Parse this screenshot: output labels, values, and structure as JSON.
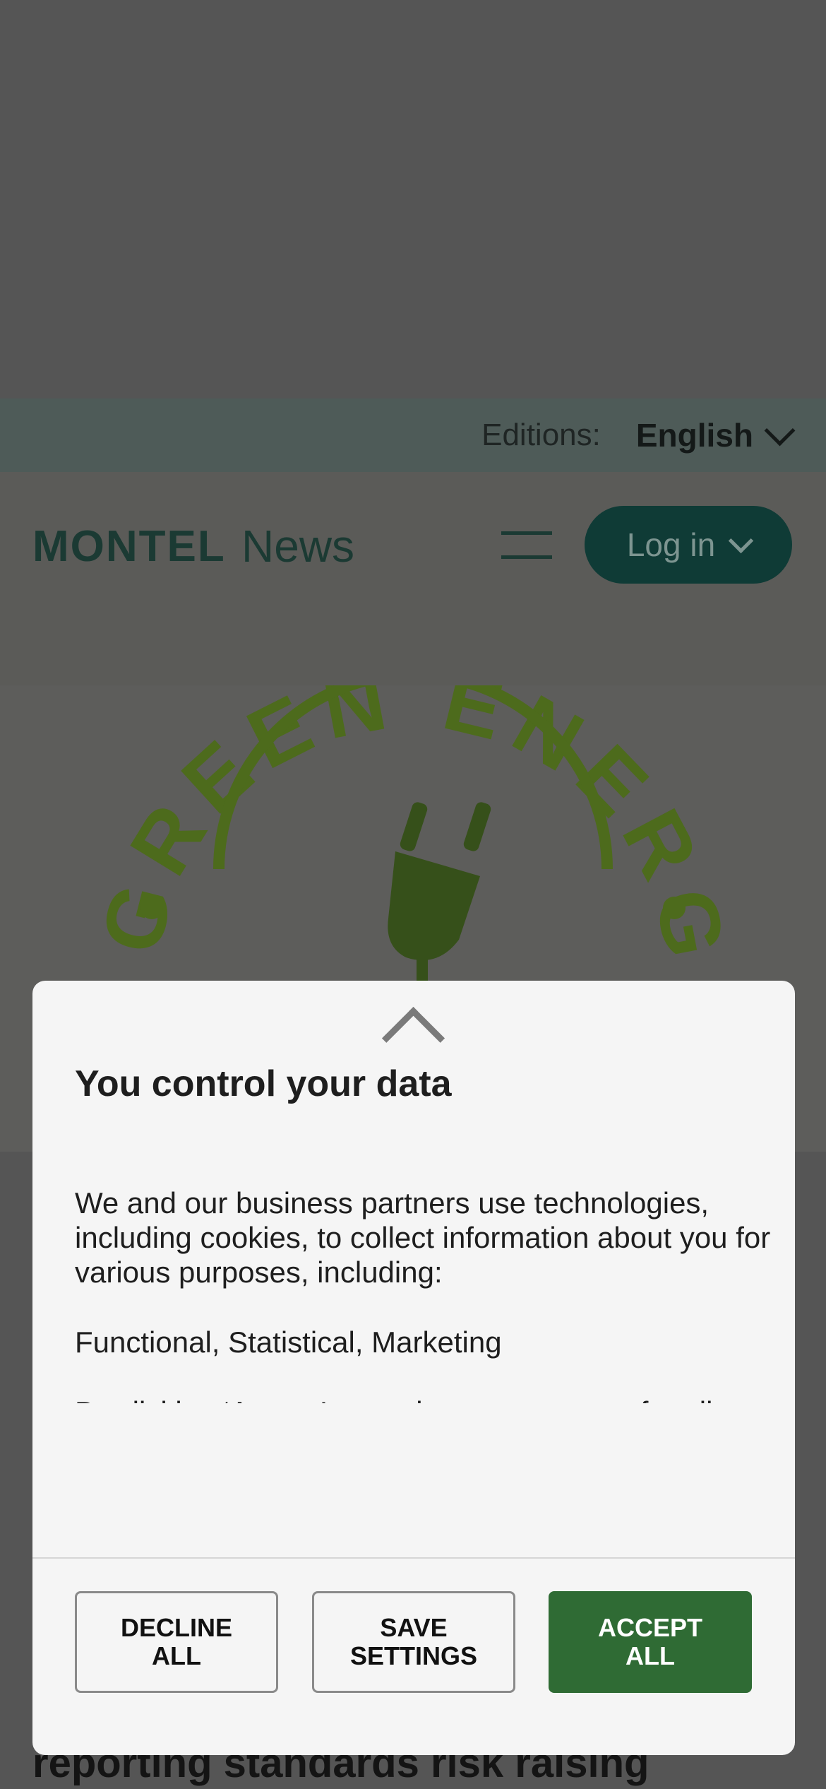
{
  "editions": {
    "label": "Editions:",
    "value": "English"
  },
  "header": {
    "logo_brand": "MONTEL",
    "logo_product": "News",
    "login_label": "Log in"
  },
  "hero_image": {
    "text": "GREEN ENERGY"
  },
  "article_peek": {
    "text": "reporting standards risk raising"
  },
  "consent_modal": {
    "title": "You control your data",
    "body": [
      "We and our business partners use technologies, including cookies, to collect information about you for various purposes, including:",
      "Functional, Statistical, Marketing",
      "By clicking ‘Accept’, you give your consent for all these purposes. You can also choose to specify the purposes you consent to by ticking the checkbox next to the purpose and clicking ‘Save settings’."
    ],
    "buttons": {
      "decline": "DECLINE\nALL",
      "save": "SAVE\nSETTINGS",
      "accept": "ACCEPT\nALL"
    }
  },
  "colors": {
    "accent_green": "#2f6b34",
    "brand_dark": "#0f3b36",
    "overlay": "#555555"
  }
}
